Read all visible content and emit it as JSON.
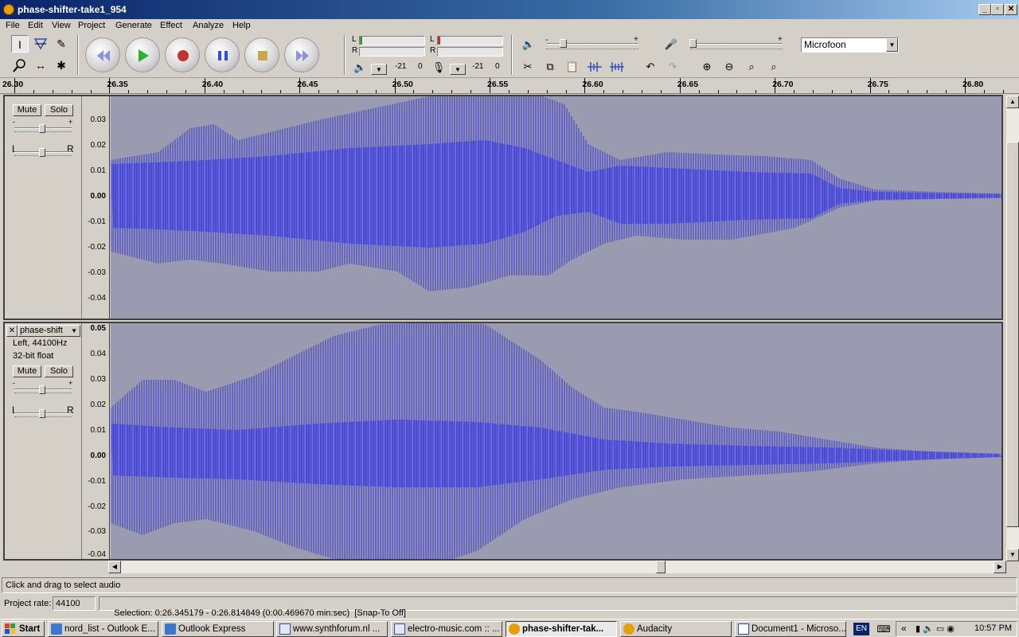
{
  "window": {
    "title": "phase-shifter-take1_954",
    "buttons": {
      "minimize": "_",
      "maximize": "▫",
      "close": "✕"
    }
  },
  "menu": [
    "File",
    "Edit",
    "View",
    "Project",
    "Generate",
    "Effect",
    "Analyze",
    "Help"
  ],
  "meters": {
    "play_left": "L",
    "play_right": "R",
    "rec_left": "L",
    "rec_right": "R",
    "play_scale_a": "-21",
    "play_scale_b": "0",
    "rec_scale_a": "-21",
    "rec_scale_b": "0"
  },
  "mixer": {
    "output_minus": "-",
    "output_plus": "+",
    "input_minus": "-",
    "input_plus": "+"
  },
  "input_device": "Microfoon",
  "ruler": {
    "labels": [
      "26.30",
      "26.35",
      "26.40",
      "26.45",
      "26.50",
      "26.55",
      "26.60",
      "26.65",
      "26.70",
      "26.75",
      "26.80"
    ]
  },
  "track1": {
    "mute": "Mute",
    "solo": "Solo",
    "gain_minus": "-",
    "gain_plus": "+",
    "pan_left": "L",
    "pan_right": "R",
    "vruler": [
      "0.03",
      "0.02",
      "0.01",
      "0.00",
      "-0.01",
      "-0.02",
      "-0.03",
      "-0.04"
    ]
  },
  "track2": {
    "name": "phase-shift",
    "info1": "Left, 44100Hz",
    "info2": "32-bit float",
    "mute": "Mute",
    "solo": "Solo",
    "gain_minus": "-",
    "gain_plus": "+",
    "pan_left": "L",
    "pan_right": "R",
    "vruler": [
      "0.05",
      "0.04",
      "0.03",
      "0.02",
      "0.01",
      "0.00",
      "-0.01",
      "-0.02",
      "-0.03",
      "-0.04"
    ]
  },
  "status": {
    "hint": "Click and drag to select audio",
    "rate_label": "Project rate:",
    "rate_value": "44100",
    "selection": "Selection: 0:26.345179 - 0:26.814849 (0:00.469670 min:sec)  [Snap-To Off]"
  },
  "taskbar": {
    "start": "Start",
    "tasks": [
      "nord_list - Outlook E...",
      "Outlook Express",
      "www.synthforum.nl ...",
      "electro-music.com :: ...",
      "phase-shifter-tak...",
      "Audacity",
      "Document1 - Microso..."
    ],
    "lang": "EN",
    "clock": "10:57 PM"
  }
}
